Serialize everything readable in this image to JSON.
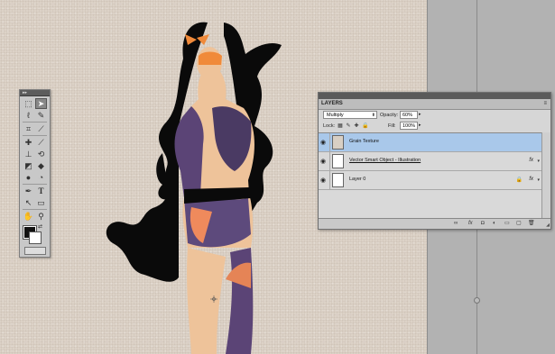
{
  "icons": {
    "tools": [
      "move-tool-icon",
      "marquee-tool-icon",
      "lasso-tool-icon",
      "quick-selection-tool-icon",
      "crop-tool-icon",
      "eyedropper-tool-icon",
      "spot-healing-tool-icon",
      "brush-tool-icon",
      "clone-stamp-tool-icon",
      "history-brush-tool-icon",
      "eraser-tool-icon",
      "paint-bucket-tool-icon",
      "blur-tool-icon",
      "dodge-tool-icon",
      "pen-tool-icon",
      "type-tool-icon",
      "path-selection-tool-icon",
      "shape-tool-icon",
      "hand-tool-icon",
      "zoom-tool-icon"
    ],
    "layer_panel_footer": [
      "link-layers-icon",
      "add-layer-style-icon",
      "add-mask-icon",
      "new-adjustment-layer-icon",
      "new-group-icon",
      "new-layer-icon",
      "delete-layer-icon"
    ]
  },
  "colors": {
    "canvas_paper": "#dcd2c7",
    "foreground_color": "#111111",
    "background_color": "#ffffff",
    "selected_layer": "#a9c8ea"
  },
  "layers_panel": {
    "tab_label": "LAYERS",
    "blend_mode": "Multiply",
    "opacity_label": "Opacity:",
    "opacity_value": "60%",
    "lock_label": "Lock:",
    "fill_label": "Fill:",
    "fill_value": "100%",
    "layers": [
      {
        "name": "Grain Texture",
        "selected": true,
        "visible": true,
        "fx": false,
        "locked": false
      },
      {
        "name": "Vector Smart Object - Illustration",
        "selected": false,
        "visible": true,
        "fx": true,
        "locked": false
      },
      {
        "name": "Layer 0",
        "selected": false,
        "visible": true,
        "fx": true,
        "locked": true
      }
    ],
    "fx_label": "fx"
  }
}
